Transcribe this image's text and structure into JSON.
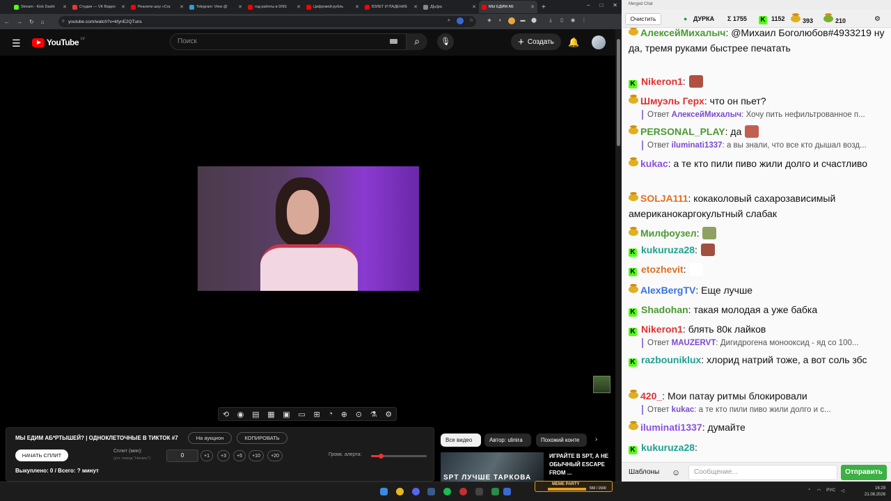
{
  "browser": {
    "tabs": [
      {
        "label": "Stream - Kick Dashi",
        "color": "#53fc18"
      },
      {
        "label": "Студия — VK Видео",
        "color": "#e53935"
      },
      {
        "label": "Реалити шоу «Сга",
        "color": "#ff0000"
      },
      {
        "label": "Telegram: View @",
        "color": "#2aa1da"
      },
      {
        "label": "год работы в DNS",
        "color": "#ff0000"
      },
      {
        "label": "Цифровой рубль",
        "color": "#ff0000"
      },
      {
        "label": "ВЗЛЕТ И ПАДЕНИЕ",
        "color": "#ff0000"
      },
      {
        "label": "Д[ы]ра",
        "color": "#888888"
      },
      {
        "label": "МЫ ЕДИМ АБ",
        "color": "#ff0000"
      }
    ],
    "url": "youtube.com/watch?v=kfynE2QTuns"
  },
  "youtube": {
    "logo_text": "YouTube",
    "region": "LV",
    "search_placeholder": "Поиск",
    "create_label": "Создать"
  },
  "panel": {
    "title": "МЫ ЕДИМ АБ*РТЫШЕЙ? | ОДНОКЛЕТОЧНЫЕ В ТИКТОК #7",
    "auction_label": "На аукцион",
    "copy_label": "КОПИРОВАТЬ",
    "start_split_label": "НАЧАТЬ СПЛИТ",
    "split_label": "Сплит (мин):",
    "split_hint": "(уст. перед \"Начать\")",
    "split_value": "0",
    "increments": [
      "+1",
      "+3",
      "+5",
      "+10",
      "+20"
    ],
    "volume_label": "Громк. алерта:",
    "volume_level": 0.17,
    "bought_text": "Выкуплено: 0 / Всего: ? минут"
  },
  "related": {
    "chips": [
      "Все видео",
      "Автор: ulinira",
      "Похожий конте"
    ],
    "thumb_text": "SPT ЛУЧШЕ ТАРКОВА",
    "title": "ИГРАЙТЕ В SPT, А НЕ ОБЫЧНЫЙ ESCAPE FROM ..."
  },
  "meme_party": {
    "label": "MEME PARTY",
    "count": "550 / 1500"
  },
  "taskbar": {
    "lang": "РУС",
    "time": "16:29",
    "date": "21.08.2026"
  },
  "chat": {
    "window_title": "Merged Chat",
    "clear_label": "Очистить",
    "channel": "ДУРКА",
    "stats": {
      "sigma": "Σ 1755",
      "kick": "1152",
      "bee": "393",
      "other": "210"
    },
    "messages": [
      {
        "platform": "bee",
        "user": "АлексейМихалыч",
        "color": "#4a9a30",
        "text": "@Михаил Боголюбов#4933219 ну да, тремя руками быстрее печатать"
      },
      {
        "platform": "kick",
        "user": "Nikeron1",
        "color": "#e03030",
        "text": ""
      },
      {
        "platform": "bee",
        "user": "Шмуэль Герх",
        "color": "#e03030",
        "text": "что он пьет?"
      },
      {
        "reply_user": "АлексейМихалыч",
        "reply_text": "Хочу пить нефильтрованное п..."
      },
      {
        "platform": "bee",
        "user": "PERSONAL_PLAY",
        "color": "#4a9a30",
        "text": "да"
      },
      {
        "reply_user": "iluminati1337",
        "reply_text": "а вы знали, что все кто дышал возд..."
      },
      {
        "platform": "bee",
        "user": "kukac",
        "color": "#8a50e0",
        "text": "а те кто пили пиво жили долго и счастливо"
      },
      {
        "platform": "bee",
        "user": "SOLJA111",
        "color": "#e07020",
        "text": "кокаколовый сахарозависимый американокаргокультный слабак"
      },
      {
        "platform": "bee",
        "user": "Милфоузел",
        "color": "#4a9a30",
        "text": ""
      },
      {
        "platform": "kick",
        "user": "kukuruza28",
        "color": "#20a090",
        "text": ""
      },
      {
        "platform": "kick",
        "user": "etozhevit",
        "color": "#e07020",
        "text": ""
      },
      {
        "platform": "bee",
        "user": "AlexBergTV",
        "color": "#3a70e0",
        "text": "Еще лучше"
      },
      {
        "platform": "kick",
        "user": "Shadohan",
        "color": "#4a9a30",
        "text": "такая молодая а уже бабка"
      },
      {
        "platform": "kick",
        "user": "Nikeron1",
        "color": "#e03030",
        "text": "блять 80к лайков"
      },
      {
        "reply_user": "MAUZERVT",
        "reply_text": "Дигидрогена монооксид - яд со 100..."
      },
      {
        "platform": "kick",
        "user": "razbouniklux",
        "color": "#20a090",
        "text": "хлорид натрий тоже, а вот соль збс"
      },
      {
        "platform": "bee",
        "user": "420_",
        "color": "#e03030",
        "text": "Мои патау ритмы блокировали"
      },
      {
        "reply_user": "kukac",
        "reply_text": "а те кто пили пиво жили долго и с..."
      },
      {
        "platform": "bee",
        "user": "iluminati1337",
        "color": "#8a50e0",
        "text": "думайте"
      },
      {
        "platform": "kick",
        "user": "kukuruza28",
        "color": "#20a090",
        "text": ""
      }
    ],
    "templates_label": "Шаблоны",
    "input_placeholder": "Сообщение...",
    "send_label": "Отправить"
  }
}
